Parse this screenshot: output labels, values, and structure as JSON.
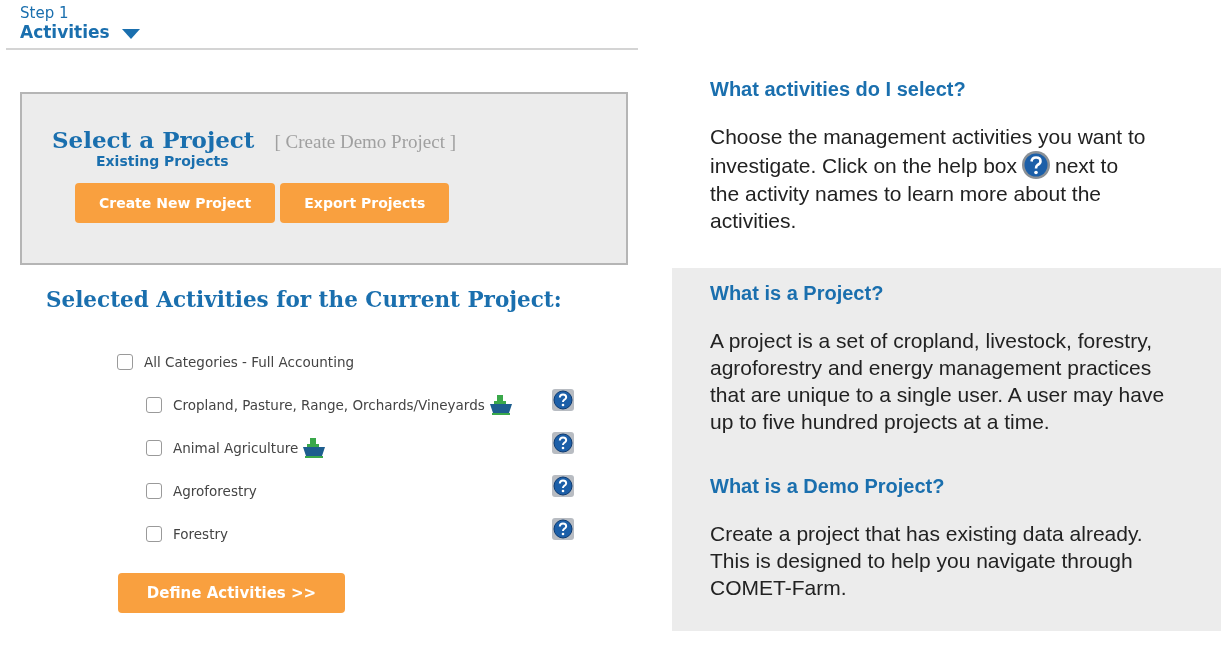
{
  "step": {
    "label": "Step 1",
    "title": "Activities",
    "expanded": true
  },
  "project_box": {
    "title": "Select a Project",
    "demo_link": "[ Create Demo Project ]",
    "existing_link": "Existing Projects",
    "buttons": [
      "Create New Project",
      "Export Projects"
    ]
  },
  "activities": {
    "heading": "Selected Activities for the Current Project:",
    "all": {
      "label": "All Categories - Full Accounting",
      "checked": false
    },
    "items": [
      {
        "label": "Cropland, Pasture, Range, Orchards/Vineyards",
        "checked": false,
        "tray_icon": true
      },
      {
        "label": "Animal Agriculture",
        "checked": false,
        "tray_icon": true
      },
      {
        "label": "Agroforestry",
        "checked": false,
        "tray_icon": false
      },
      {
        "label": "Forestry",
        "checked": false,
        "tray_icon": false
      }
    ],
    "button": "Define Activities >>"
  },
  "help": [
    {
      "heading": "What activities do I select?",
      "line_1": "Choose the management activities you want to",
      "before_icon": "investigate. Click on the help box",
      "after_icon": "next to",
      "rest": "the activity names to learn more about the activities."
    },
    {
      "heading": "What is a Project?",
      "text": "A project is a set of cropland, livestock, forestry, agroforestry and energy management practices that are unique to a single user. A user may have up to five hundred projects at a time."
    },
    {
      "heading": "What is a Demo Project?",
      "text": "Create a project that has existing data already. This is designed to help you navigate through COMET-Farm."
    }
  ]
}
